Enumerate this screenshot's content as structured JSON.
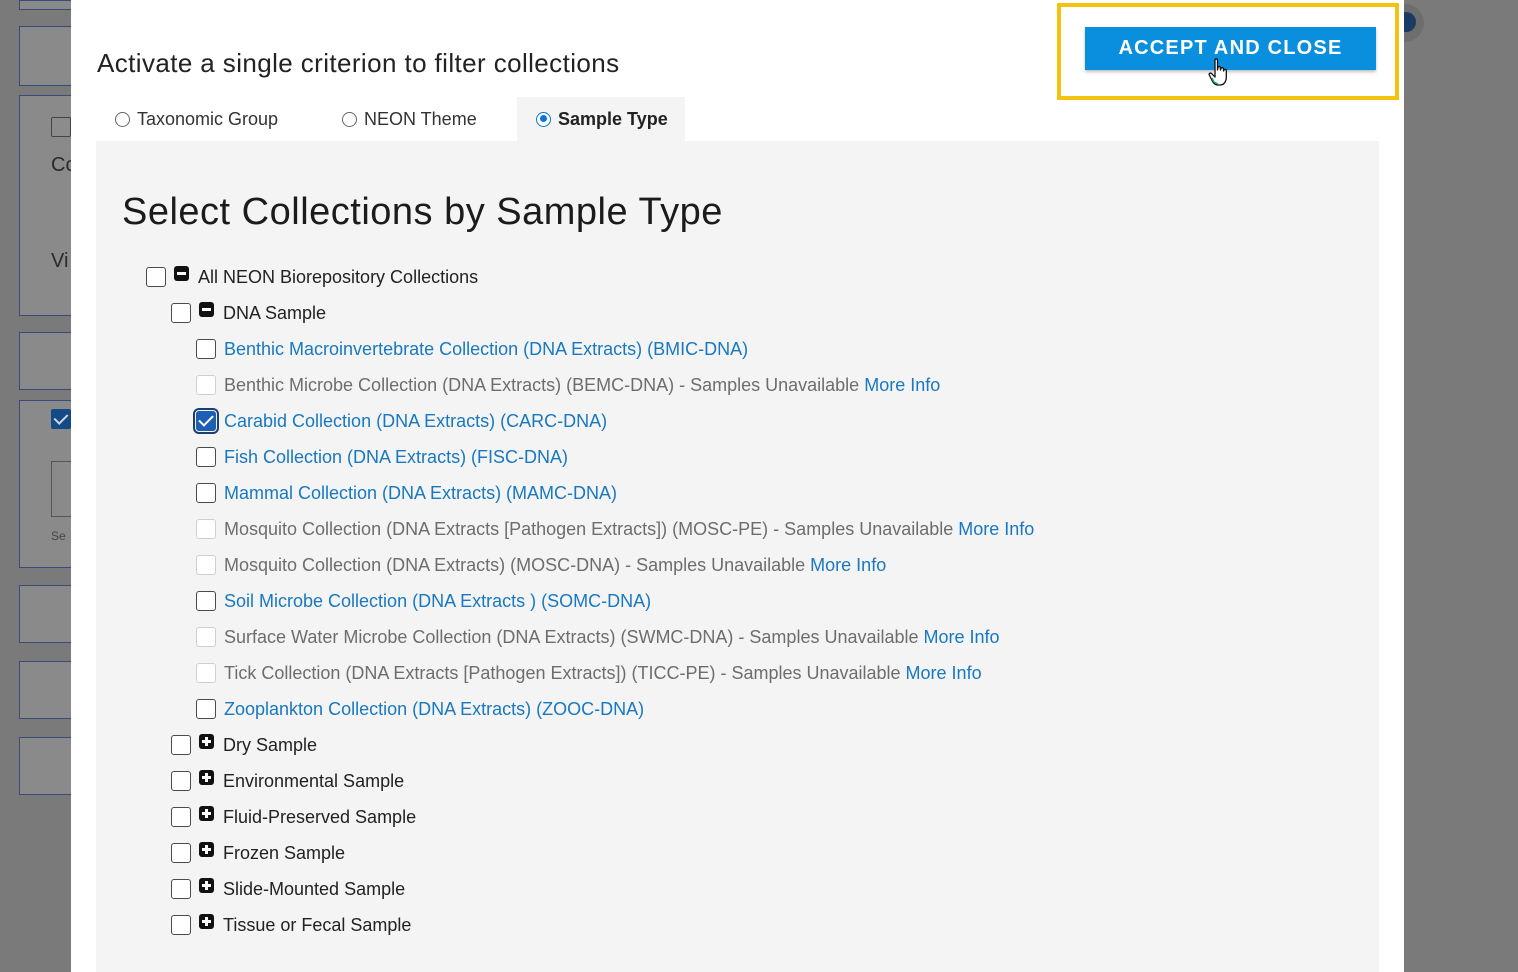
{
  "background": {
    "text_co": "Co",
    "text_vi": "Vi",
    "text_se": "Se"
  },
  "modal": {
    "title": "Activate a single criterion to filter collections",
    "accept_button": "ACCEPT AND CLOSE",
    "tabs": [
      {
        "label": "Taxonomic Group",
        "selected": false
      },
      {
        "label": "NEON Theme",
        "selected": false
      },
      {
        "label": "Sample Type",
        "selected": true
      }
    ],
    "panel_heading": "Select Collections by Sample Type",
    "tree": {
      "root": {
        "label": "All NEON Biorepository Collections",
        "checked": false,
        "expanded": true
      },
      "dna_sample": {
        "label": "DNA Sample",
        "checked": false,
        "expanded": true
      },
      "dna_items": [
        {
          "label": "Benthic Macroinvertebrate Collection (DNA Extracts) (BMIC-DNA)",
          "checked": false,
          "available": true
        },
        {
          "label": "Benthic Microbe Collection (DNA Extracts) (BEMC-DNA) - Samples Unavailable",
          "checked": false,
          "available": false,
          "more_info": "More Info"
        },
        {
          "label": "Carabid Collection (DNA Extracts) (CARC-DNA)",
          "checked": true,
          "available": true
        },
        {
          "label": "Fish Collection (DNA Extracts) (FISC-DNA)",
          "checked": false,
          "available": true
        },
        {
          "label": "Mammal Collection (DNA Extracts) (MAMC-DNA)",
          "checked": false,
          "available": true
        },
        {
          "label": "Mosquito Collection (DNA Extracts [Pathogen Extracts]) (MOSC-PE) - Samples Unavailable",
          "checked": false,
          "available": false,
          "more_info": "More Info"
        },
        {
          "label": "Mosquito Collection (DNA Extracts) (MOSC-DNA) - Samples Unavailable",
          "checked": false,
          "available": false,
          "more_info": "More Info"
        },
        {
          "label": "Soil Microbe Collection (DNA Extracts ) (SOMC-DNA)",
          "checked": false,
          "available": true
        },
        {
          "label": "Surface Water Microbe Collection (DNA Extracts) (SWMC-DNA) - Samples Unavailable",
          "checked": false,
          "available": false,
          "more_info": "More Info"
        },
        {
          "label": "Tick Collection (DNA Extracts [Pathogen Extracts]) (TICC-PE) - Samples Unavailable",
          "checked": false,
          "available": false,
          "more_info": "More Info"
        },
        {
          "label": "Zooplankton Collection (DNA Extracts) (ZOOC-DNA)",
          "checked": false,
          "available": true
        }
      ],
      "collapsed_groups": [
        {
          "label": "Dry Sample",
          "checked": false,
          "expanded": false
        },
        {
          "label": "Environmental Sample",
          "checked": false,
          "expanded": false
        },
        {
          "label": "Fluid-Preserved Sample",
          "checked": false,
          "expanded": false
        },
        {
          "label": "Frozen Sample",
          "checked": false,
          "expanded": false
        },
        {
          "label": "Slide-Mounted Sample",
          "checked": false,
          "expanded": false
        },
        {
          "label": "Tissue or Fecal Sample",
          "checked": false,
          "expanded": false
        }
      ]
    }
  },
  "colors": {
    "accent_button": "#0a8fde",
    "link": "#1878c0",
    "highlight": "#f2c40f",
    "checkbox_checked": "#1d5fb4"
  }
}
